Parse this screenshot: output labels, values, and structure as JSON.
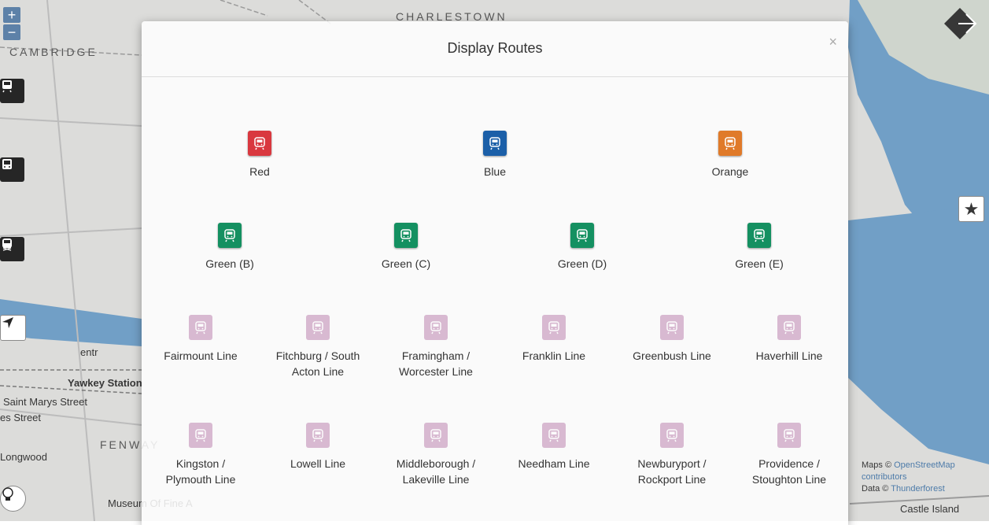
{
  "map": {
    "labels": {
      "cambridge": "CAMBRIDGE",
      "charlestown": "CHARLESTOWN",
      "fenway": "FENWAY",
      "yawkey": "Yawkey Station",
      "entr": "entr",
      "saint_marys": "Saint Marys Street",
      "es_street": "es Street",
      "longwood": "Longwood",
      "museum": "Museum Of Fine A",
      "castle_island": "Castle Island"
    },
    "zoom_in": "+",
    "zoom_out": "−",
    "attribution": {
      "maps_prefix": "Maps ©",
      "maps_link": "OpenStreetMap contributors",
      "data_prefix": "Data ©",
      "data_link": "Thunderforest"
    }
  },
  "modal": {
    "title": "Display Routes",
    "close": "×",
    "subway_routes": [
      {
        "label": "Red",
        "color": "#d9383f"
      },
      {
        "label": "Blue",
        "color": "#1b5fa8"
      },
      {
        "label": "Orange",
        "color": "#e07a29"
      }
    ],
    "green_routes": [
      {
        "label": "Green (B)",
        "color": "#149061"
      },
      {
        "label": "Green (C)",
        "color": "#149061"
      },
      {
        "label": "Green (D)",
        "color": "#149061"
      },
      {
        "label": "Green (E)",
        "color": "#149061"
      }
    ],
    "commuter_rail_color": "#b06ba0",
    "commuter_rail": [
      [
        "Fairmount Line"
      ],
      [
        "Fitchburg / South",
        "Acton Line"
      ],
      [
        "Framingham /",
        "Worcester Line"
      ],
      [
        "Franklin Line"
      ],
      [
        "Greenbush Line"
      ],
      [
        "Haverhill Line"
      ],
      [
        "Kingston /",
        "Plymouth Line"
      ],
      [
        "Lowell Line"
      ],
      [
        "Middleborough /",
        "Lakeville Line"
      ],
      [
        "Needham Line"
      ],
      [
        "Newburyport /",
        "Rockport Line"
      ],
      [
        "Providence /",
        "Stoughton Line"
      ]
    ]
  }
}
